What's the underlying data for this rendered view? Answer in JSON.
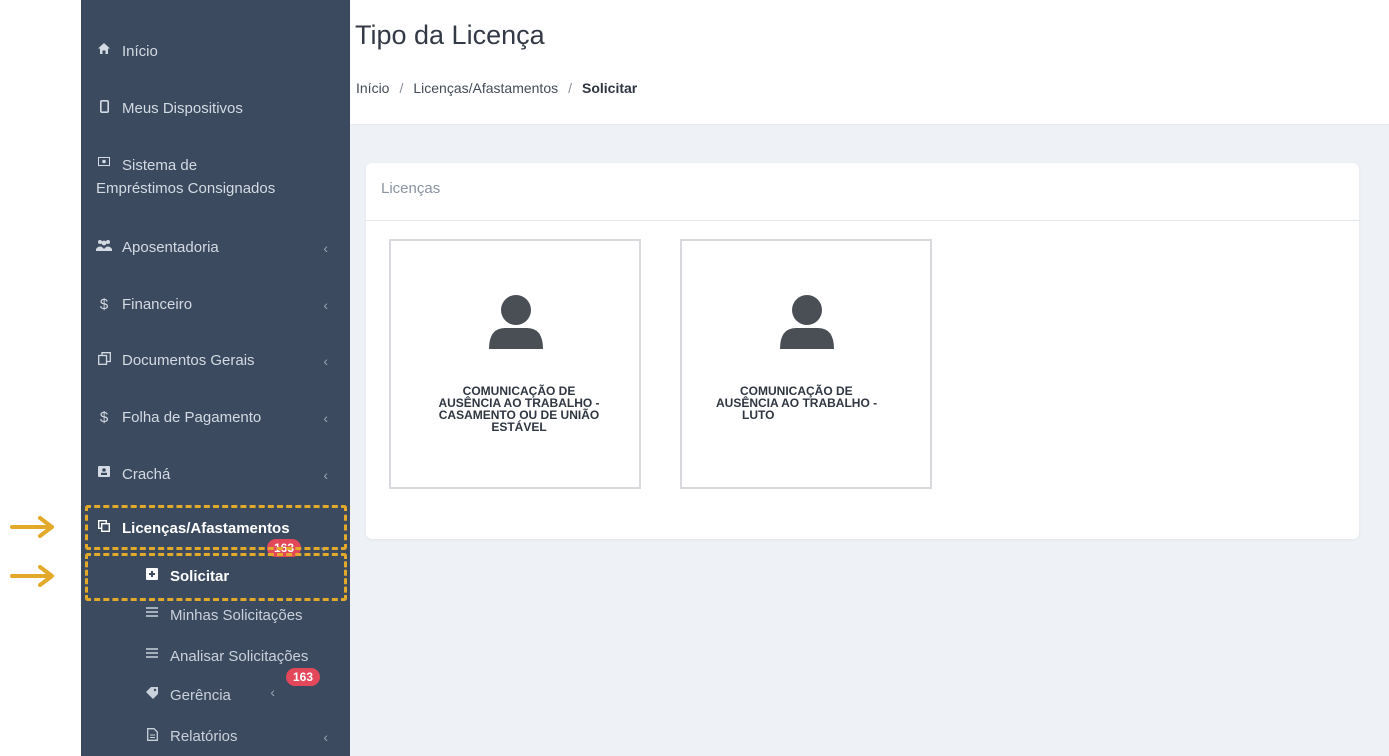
{
  "sidebar": {
    "items": [
      {
        "label": "Início",
        "icon": "home-icon"
      },
      {
        "label": "Meus Dispositivos",
        "icon": "mobile-icon"
      },
      {
        "label_line1": "Sistema de",
        "label_line2": "Empréstimos Consignados",
        "icon": "money-icon"
      },
      {
        "label": "Aposentadoria",
        "icon": "users-icon"
      },
      {
        "label": "Financeiro",
        "icon": "dollar-icon",
        "glyph": "$"
      },
      {
        "label": "Documentos Gerais",
        "icon": "documents-icon"
      },
      {
        "label": "Folha de Pagamento",
        "icon": "dollar-icon",
        "glyph": "$"
      },
      {
        "label": "Crachá",
        "icon": "id-card-icon"
      },
      {
        "label": "Licenças/Afastamentos",
        "icon": "copy-icon",
        "badge": "163"
      }
    ],
    "sub_items": [
      {
        "label": "Solicitar",
        "icon": "plus-square-icon"
      },
      {
        "label": "Minhas Solicitações",
        "icon": "list-icon"
      },
      {
        "label": "Analisar Solicitações",
        "icon": "list-icon",
        "badge": "163"
      },
      {
        "label": "Gerência",
        "icon": "tag-icon"
      },
      {
        "label": "Relatórios",
        "icon": "file-icon"
      }
    ],
    "chevron": "‹",
    "bg_color": "#3b4a5e",
    "highlight_color": "#e3a92b",
    "badge_color": "#e2475a"
  },
  "header": {
    "title": "Tipo da Licença",
    "breadcrumb": [
      "Início",
      "Licenças/Afastamentos",
      "Solicitar"
    ],
    "separator": "/"
  },
  "card": {
    "title": "Licenças",
    "tiles": [
      {
        "lines": [
          "COMUNICAÇÃO DE",
          "AUSÊNCIA AO TRABALHO -",
          "CASAMENTO OU DE UNIÃO",
          "ESTÁVEL"
        ],
        "icon": "user-icon"
      },
      {
        "lines": [
          "COMUNICAÇÃO DE",
          "AUSÊNCIA AO TRABALHO -",
          "LUTO"
        ],
        "icon": "user-icon"
      }
    ]
  }
}
